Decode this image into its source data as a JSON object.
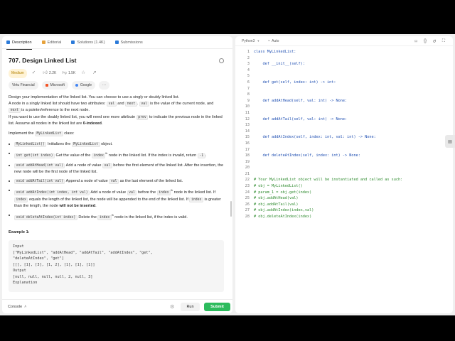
{
  "tabs": [
    {
      "label": "Description",
      "icon": "document-icon",
      "color": "#2b7ad9"
    },
    {
      "label": "Editorial",
      "icon": "book-icon",
      "color": "#e6a23c"
    },
    {
      "label": "Solutions (1.4K)",
      "icon": "flask-icon",
      "color": "#2b7ad9"
    },
    {
      "label": "Submissions",
      "icon": "history-icon",
      "color": "#2b7ad9"
    }
  ],
  "problem": {
    "title": "707. Design Linked List",
    "difficulty": "Medium",
    "likes": "2.2K",
    "dislikes": "1.5K",
    "companies": [
      "Virtu Financial",
      "Microsoft",
      "Google",
      "···"
    ]
  },
  "description": {
    "p1": "Design your implementation of the linked list. You can choose to use a singly or doubly linked list.",
    "p2a": "A node in a singly linked list should have two attributes: ",
    "p2_val": "val",
    "p2b": " and ",
    "p2_next": "next",
    "p2c": ". ",
    "p2_val2": "val",
    "p2d": " is the value of the current node, and ",
    "p2_next2": "next",
    "p2e": " is a pointer/reference to the next node.",
    "p3a": "If you want to use the doubly linked list, you will need one more attribute ",
    "p3_prev": "prev",
    "p3b": " to indicate the previous node in the linked list. Assume all nodes in the linked list are ",
    "p3_bold": "0-indexed",
    "p3c": ".",
    "impl_a": "Implement the ",
    "impl_code": "MyLinkedList",
    "impl_b": " class:"
  },
  "methods": [
    {
      "sig": "MyLinkedList()",
      "text": " Initializes the ",
      "code2": "MyLinkedList",
      "text2": " object."
    },
    {
      "sig": "int get(int index)",
      "text": " Get the value of the ",
      "code2": "index",
      "sup": "th",
      "text2": " node in the linked list. If the index is invalid, return ",
      "code3": "-1",
      "text3": "."
    },
    {
      "sig": "void addAtHead(int val)",
      "text": " Add a node of value ",
      "code2": "val",
      "text2": " before the first element of the linked list. After the insertion, the new node will be the first node of the linked list."
    },
    {
      "sig": "void addAtTail(int val)",
      "text": " Append a node of value ",
      "code2": "val",
      "text2": " as the last element of the linked list."
    },
    {
      "sig": "void addAtIndex(int index, int val)",
      "text": " Add a node of value ",
      "code2": "val",
      "text2": " before the ",
      "code3": "index",
      "sup": "th",
      "text3": " node in the linked list. If ",
      "code4": "index",
      "text4": " equals the length of the linked list, the node will be appended to the end of the linked list. If ",
      "code5": "index",
      "text5": " is greater than the length, the node ",
      "bold": "will not be inserted",
      "text6": "."
    },
    {
      "sig": "void deleteAtIndex(int index)",
      "text": " Delete the ",
      "code2": "index",
      "sup": "th",
      "text2": " node in the linked list, if the index is valid."
    }
  ],
  "example": {
    "heading": "Example 1:",
    "lines": [
      "Input",
      "[\"MyLinkedList\", \"addAtHead\", \"addAtTail\", \"addAtIndex\", \"get\",",
      "\"deleteAtIndex\", \"get\"]",
      "[[], [1], [3], [1, 2], [1], [1], [1]]",
      "Output",
      "[null, null, null, null, 2, null, 3]"
    ],
    "more": "Explanation"
  },
  "footer": {
    "console": "Console",
    "run": "Run",
    "submit": "Submit"
  },
  "editor": {
    "language": "Python3",
    "mode": "Auto",
    "lines": [
      {
        "n": "1",
        "code": "class MyLinkedList:",
        "kind": "code"
      },
      {
        "n": "2",
        "code": "",
        "kind": "code"
      },
      {
        "n": "3",
        "code": "    def __init__(self):",
        "kind": "code"
      },
      {
        "n": "4",
        "code": "",
        "kind": "code"
      },
      {
        "n": "5",
        "code": "",
        "kind": "code"
      },
      {
        "n": "6",
        "code": "    def get(self, index: int) -> int:",
        "kind": "code"
      },
      {
        "n": "7",
        "code": "",
        "kind": "code"
      },
      {
        "n": "8",
        "code": "",
        "kind": "code"
      },
      {
        "n": "9",
        "code": "    def addAtHead(self, val: int) -> None:",
        "kind": "code"
      },
      {
        "n": "10",
        "code": "",
        "kind": "code"
      },
      {
        "n": "11",
        "code": "",
        "kind": "code"
      },
      {
        "n": "12",
        "code": "    def addAtTail(self, val: int) -> None:",
        "kind": "code"
      },
      {
        "n": "13",
        "code": "",
        "kind": "code"
      },
      {
        "n": "14",
        "code": "",
        "kind": "code"
      },
      {
        "n": "15",
        "code": "    def addAtIndex(self, index: int, val: int) -> None:",
        "kind": "code"
      },
      {
        "n": "16",
        "code": "",
        "kind": "code"
      },
      {
        "n": "17",
        "code": "",
        "kind": "code"
      },
      {
        "n": "18",
        "code": "    def deleteAtIndex(self, index: int) -> None:",
        "kind": "code"
      },
      {
        "n": "19",
        "code": "",
        "kind": "code"
      },
      {
        "n": "20",
        "code": "",
        "kind": "code"
      },
      {
        "n": "21",
        "code": "",
        "kind": "code"
      },
      {
        "n": "22",
        "code": "# Your MyLinkedList object will be instantiated and called as such:",
        "kind": "comment"
      },
      {
        "n": "23",
        "code": "# obj = MyLinkedList()",
        "kind": "comment"
      },
      {
        "n": "24",
        "code": "# param_1 = obj.get(index)",
        "kind": "comment"
      },
      {
        "n": "25",
        "code": "# obj.addAtHead(val)",
        "kind": "comment"
      },
      {
        "n": "26",
        "code": "# obj.addAtTail(val)",
        "kind": "comment"
      },
      {
        "n": "27",
        "code": "# obj.addAtIndex(index,val)",
        "kind": "comment"
      },
      {
        "n": "28",
        "code": "# obj.deleteAtIndex(index)",
        "kind": "comment"
      }
    ]
  },
  "colors": {
    "accent": "#2cbb5d",
    "medium": "#b38100",
    "comment": "#2e8b2e",
    "keyword": "#1f4fb2"
  }
}
